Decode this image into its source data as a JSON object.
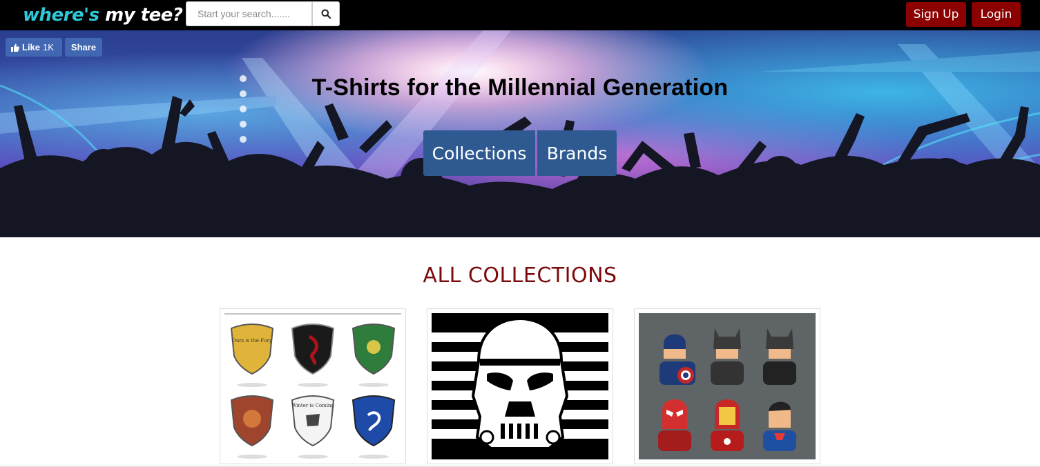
{
  "navbar": {
    "logo_part1": "where's",
    "logo_part2": "my tee?",
    "search_placeholder": "Start your search.......",
    "search_icon": "search-icon",
    "signup_label": "Sign Up",
    "login_label": "Login"
  },
  "social": {
    "like_label": "Like",
    "like_count": "1K",
    "share_label": "Share"
  },
  "hero": {
    "title": "T-Shirts for the Millennial Generation",
    "collections_label": "Collections",
    "brands_label": "Brands"
  },
  "collections": {
    "heading": "ALL COLLECTIONS",
    "cards": [
      {
        "subject": "house-crests",
        "crest_texts": [
          "Ours is the Fury",
          "",
          "",
          "",
          "Winter is Coming",
          ""
        ]
      },
      {
        "subject": "stormtrooper-helmet"
      },
      {
        "subject": "superheroes"
      }
    ]
  },
  "colors": {
    "navbar_bg": "#000000",
    "logo_accent": "#2ec8d8",
    "auth_button": "#8b0000",
    "hero_button": "#2e5a91",
    "facebook": "#4267b2",
    "section_heading": "#7a0b0b"
  }
}
